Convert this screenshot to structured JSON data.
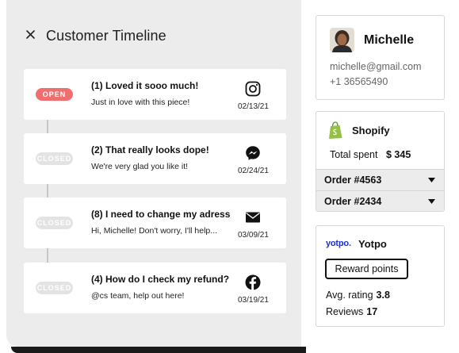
{
  "timeline": {
    "title": "Customer Timeline",
    "events": [
      {
        "status": "OPEN",
        "title": "(1) Loved it sooo much!",
        "text": "Just in love with this piece!",
        "channel": "instagram-icon",
        "date": "02/13/21"
      },
      {
        "status": "CLOSED",
        "title": "(2) That really looks dope!",
        "text": "We're very glad you like it!",
        "channel": "messenger-icon",
        "date": "02/24/21"
      },
      {
        "status": "CLOSED",
        "title": "(8) I need to change my adress",
        "text": "Hi, Michelle! Don't worry, I'll help...",
        "channel": "mail-icon",
        "date": "03/09/21"
      },
      {
        "status": "CLOSED",
        "title": "(4) How do I check my refund?",
        "text": "@cs team, help out here!",
        "channel": "facebook-icon",
        "date": "03/19/21"
      }
    ]
  },
  "customer": {
    "name": "Michelle",
    "email": "michelle@gmail.com",
    "phone": "+1 36565490"
  },
  "shopify": {
    "title": "Shopify",
    "spent_label": "Total spent",
    "spent_value": "$ 345",
    "orders": [
      "Order #4563",
      "Order #2434"
    ]
  },
  "yotpo": {
    "logo_text": "yotpo.",
    "title": "Yotpo",
    "reward_label": "Reward points",
    "rating_label": "Avg. rating",
    "rating_value": "3.8",
    "reviews_label": "Reviews",
    "reviews_value": "17"
  },
  "colors": {
    "open_badge": "#ef6f6f",
    "closed_badge": "#e3e3e3",
    "panel_bg": "#ececec",
    "shopify_green": "#95bf47",
    "yotpo_blue": "#1e2ecf"
  }
}
